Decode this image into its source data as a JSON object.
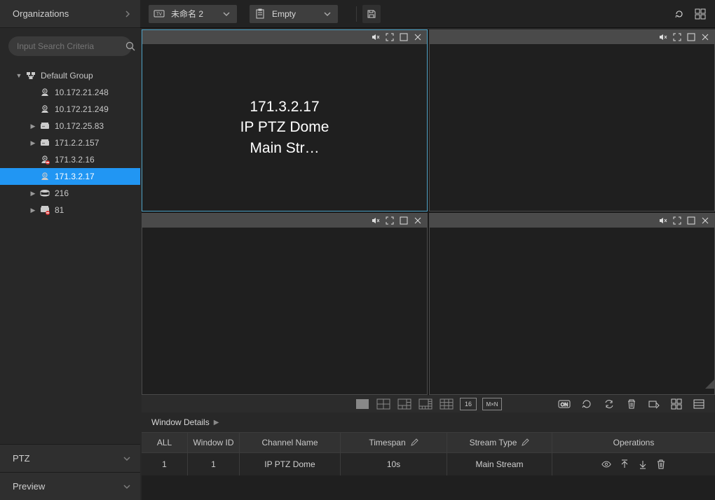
{
  "sidebar": {
    "header": "Organizations",
    "search_placeholder": "Input Search Criteria",
    "group_label": "Default Group",
    "items": [
      {
        "label": "10.172.21.248",
        "kind": "camera",
        "exp": false
      },
      {
        "label": "10.172.21.249",
        "kind": "camera",
        "exp": false
      },
      {
        "label": "10.172.25.83",
        "kind": "device",
        "exp": true
      },
      {
        "label": "171.2.2.157",
        "kind": "device",
        "exp": true
      },
      {
        "label": "171.3.2.16",
        "kind": "camera-off",
        "exp": false
      },
      {
        "label": "171.3.2.17",
        "kind": "camera",
        "exp": false,
        "selected": true
      },
      {
        "label": "216",
        "kind": "disk",
        "exp": true
      },
      {
        "label": "81",
        "kind": "device-off",
        "exp": true
      }
    ],
    "ptz_label": "PTZ",
    "preview_label": "Preview"
  },
  "toolbar": {
    "slot1_label": "未命名 2",
    "slot2_label": "Empty"
  },
  "panes": {
    "active": {
      "line1": "171.3.2.17",
      "line2": "IP PTZ Dome",
      "line3": "Main Str…"
    }
  },
  "strip": {
    "badge16": "16",
    "badgeMN": "M×N"
  },
  "details": {
    "header": "Window Details",
    "columns": {
      "all": "ALL",
      "wid": "Window ID",
      "ch": "Channel Name",
      "ts": "Timespan",
      "st": "Stream Type",
      "ops": "Operations"
    },
    "row": {
      "all": "1",
      "wid": "1",
      "ch": "IP PTZ Dome",
      "ts": "10s",
      "st": "Main Stream"
    }
  }
}
